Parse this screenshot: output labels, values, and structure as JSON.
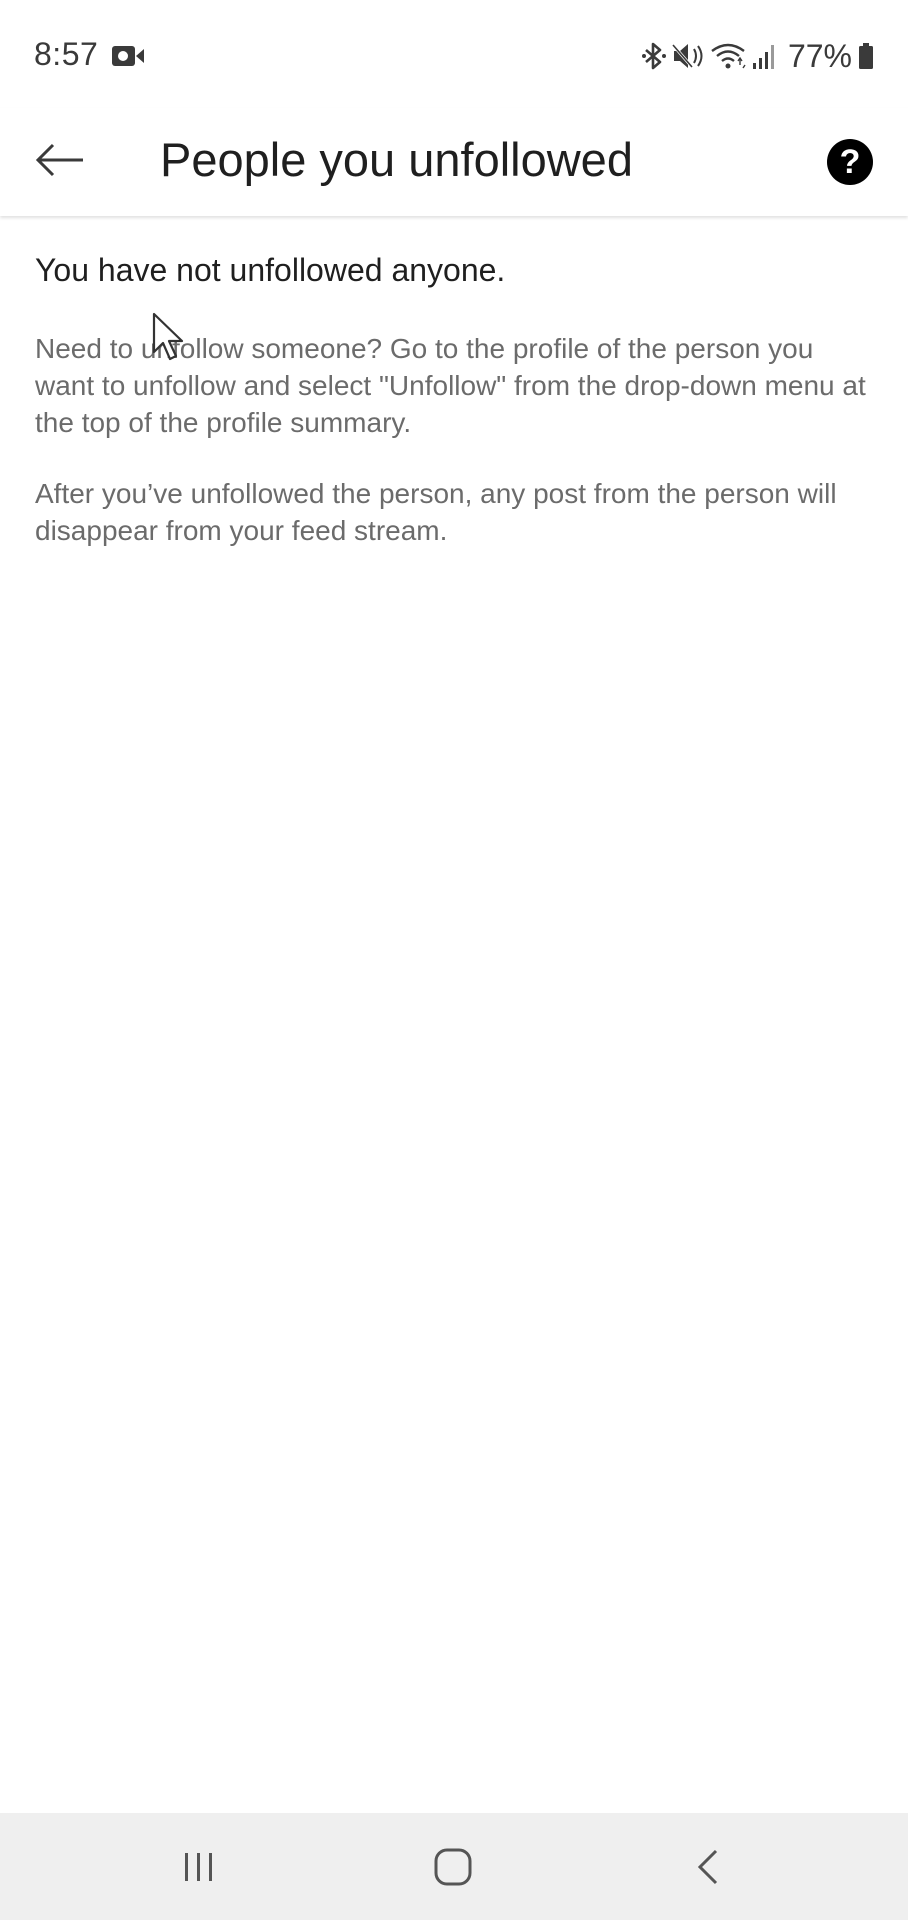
{
  "status_bar": {
    "time": "8:57",
    "battery": "77%",
    "icons": [
      "screen-record-icon",
      "bluetooth-icon",
      "mute-icon",
      "wifi-icon",
      "signal-icon",
      "battery-icon"
    ]
  },
  "app_bar": {
    "title": "People you unfollowed",
    "back_icon": "arrow-left-icon",
    "help_icon": "question-circle-icon",
    "help_glyph": "?"
  },
  "content": {
    "heading": "You have not unfollowed anyone.",
    "paragraph_1": "Need to unfollow someone? Go to the profile of the person you want to unfollow and select \"Unfollow\" from the drop-down menu at the top of the profile summary.",
    "paragraph_2": "After you’ve unfollowed the person, any post from the person will disappear from your feed stream."
  },
  "nav_bar": {
    "recent_icon": "recent-apps-icon",
    "home_icon": "home-icon",
    "back_icon": "nav-back-icon"
  },
  "colors": {
    "text_primary": "#1f1f1f",
    "text_secondary": "#6b6b6b",
    "nav_background": "#efefef",
    "help_background": "#000000"
  }
}
